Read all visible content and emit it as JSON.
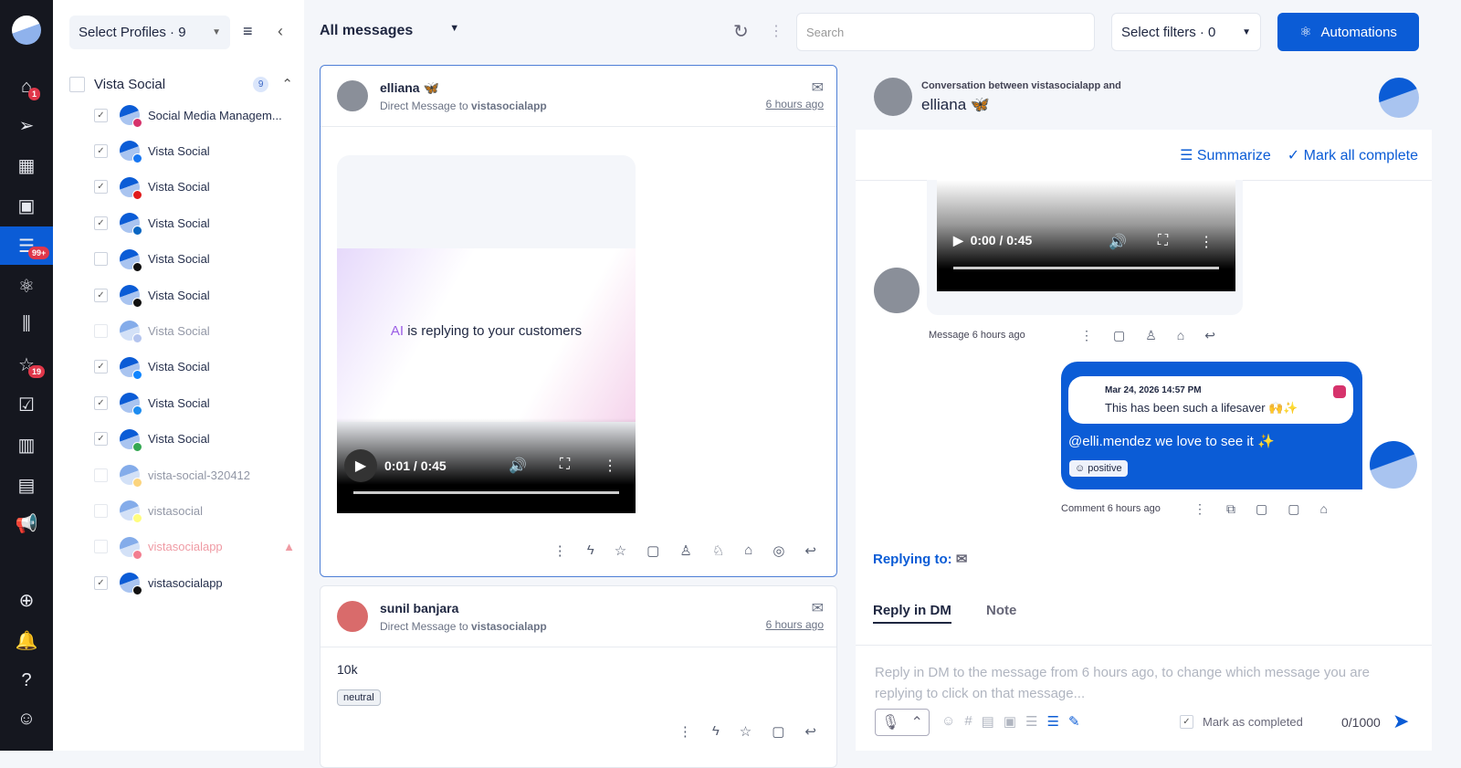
{
  "nav": {
    "badges": {
      "home": "1",
      "inbox": "99+",
      "reviews": "19"
    }
  },
  "profiles": {
    "select_label": "Select Profiles · 9",
    "group": "Vista Social",
    "group_count": "9",
    "items": [
      {
        "name": "Social Media Managem...",
        "checked": true,
        "net": "#d6336c"
      },
      {
        "name": "Vista Social",
        "checked": true,
        "net": "#1877f2"
      },
      {
        "name": "Vista Social",
        "checked": true,
        "net": "#e01b1b"
      },
      {
        "name": "Vista Social",
        "checked": true,
        "net": "#0a66c2"
      },
      {
        "name": "Vista Social",
        "checked": false,
        "net": "#111"
      },
      {
        "name": "Vista Social",
        "checked": true,
        "net": "#111"
      },
      {
        "name": "Vista Social",
        "checked": false,
        "net": "#6b8ce0",
        "dim": true
      },
      {
        "name": "Vista Social",
        "checked": true,
        "net": "#1185fe"
      },
      {
        "name": "Vista Social",
        "checked": true,
        "net": "#1d8cf0"
      },
      {
        "name": "Vista Social",
        "checked": true,
        "net": "#34a853"
      },
      {
        "name": "vista-social-320412",
        "checked": false,
        "net": "#f9ab00",
        "dim": true
      },
      {
        "name": "vistasocial",
        "checked": false,
        "net": "#fffc00",
        "dim": true
      },
      {
        "name": "vistasocialapp",
        "checked": false,
        "net": "#e60023",
        "dim": true,
        "error": true
      },
      {
        "name": "vistasocialapp",
        "checked": true,
        "net": "#111"
      }
    ]
  },
  "header": {
    "view": "All messages",
    "search_placeholder": "Search",
    "filters": "Select filters · 0",
    "automations": "Automations"
  },
  "messages": [
    {
      "name": "elliana 🦋",
      "sub_prefix": "Direct Message to ",
      "sub_account": "vistasocialapp",
      "time": "6 hours ago",
      "video_text_ai": "AI",
      "video_text": " is replying to your customers",
      "video_time": "0:01 / 0:45"
    },
    {
      "name": "sunil banjara",
      "sub_prefix": "Direct Message to ",
      "sub_account": "vistasocialapp",
      "time": "6 hours ago",
      "text": "10k",
      "sentiment": "neutral"
    }
  ],
  "conversation": {
    "caption": "Conversation between vistasocialapp and",
    "name": "elliana 🦋",
    "summarize": "Summarize",
    "mark_all": "Mark all complete",
    "video_time": "0:00 / 0:45",
    "msg_meta": "Message 6 hours ago",
    "quote_date": "Mar 24, 2026 14:57 PM",
    "quote_text": "This has been such a lifesaver 🙌✨",
    "reply_text": "@elli.mendez we love to see it ✨",
    "reply_sentiment": "positive",
    "reply_meta": "Comment 6 hours ago",
    "replying_to": "Replying to:",
    "tabs": [
      "Reply in DM",
      "Note"
    ],
    "placeholder": "Reply in DM to the message from 6 hours ago, to change which message you are replying to click on that message...",
    "mark_completed": "Mark as completed",
    "counter": "0/1000"
  }
}
